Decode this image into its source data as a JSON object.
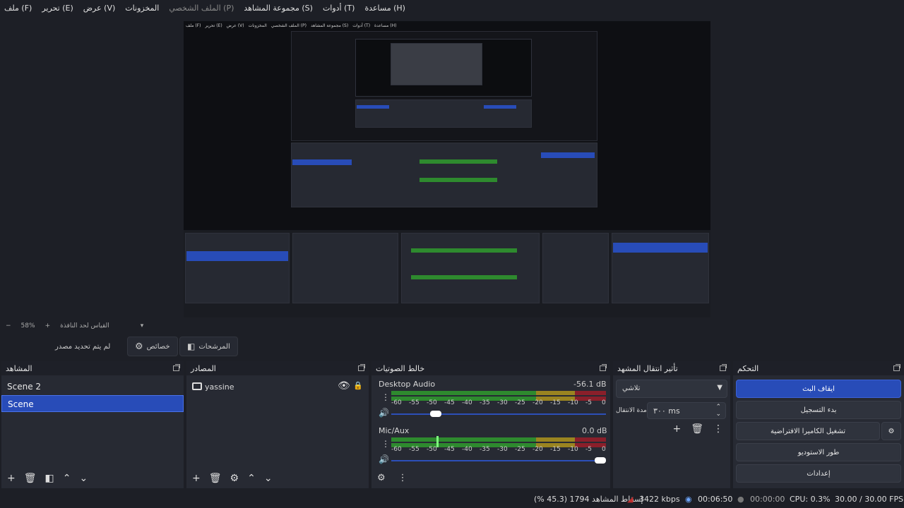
{
  "menu": [
    "ملف (F)",
    "تحرير (E)",
    "عرض (V)",
    "المخزونات",
    "الملف الشخصي (P)",
    "مجموعة المشاهد (S)",
    "أدوات (T)",
    "مساعدة (H)"
  ],
  "zoom": {
    "percent": "58%",
    "fit_label": "القياس لحد النافذة"
  },
  "toolbar": {
    "no_source": "لم يتم تحديد مصدر",
    "properties": "خصائص",
    "filters": "المرشحات"
  },
  "scenes": {
    "title": "المشاهد",
    "items": [
      "Scene 2",
      "Scene"
    ],
    "selected": 1
  },
  "sources": {
    "title": "المصادر",
    "items": [
      {
        "name": "yassine"
      }
    ]
  },
  "mixer": {
    "title": "خالط الصوتيات",
    "channels": [
      {
        "name": "Desktop Audio",
        "level": "-56.1 dB",
        "volume_fraction": 0.19
      },
      {
        "name": "Mic/Aux",
        "level": "0.0 dB",
        "volume_fraction": 1.0
      }
    ],
    "scale": [
      "-60",
      "-55",
      "-50",
      "-45",
      "-40",
      "-35",
      "-30",
      "-25",
      "-20",
      "-15",
      "-10",
      "-5",
      "0"
    ]
  },
  "transitions": {
    "title": "تأثير انتقال المشهد",
    "selected": "تلاشي",
    "duration_label": "مدة الانتقال",
    "duration_value": "٣٠٠ ms"
  },
  "controls": {
    "title": "التحكم",
    "buttons": [
      "ايقاف البث",
      "بدء التسجيل",
      "تشغيل الكاميرا الافتراضية",
      "طور الاستوديو",
      "إعدادات"
    ]
  },
  "status": {
    "dropped": "إسقاط المشاهد 1794 (45.3 %)",
    "bitrate": "3422 kbps",
    "stream_time": "00:06:50",
    "rec_time": "00:00:00",
    "cpu": "CPU: 0.3%",
    "fps": "30.00 / 30.00 FPS"
  },
  "colors": {
    "accent": "#284cb8",
    "panel": "#272a33",
    "bg": "#1d1f26"
  }
}
